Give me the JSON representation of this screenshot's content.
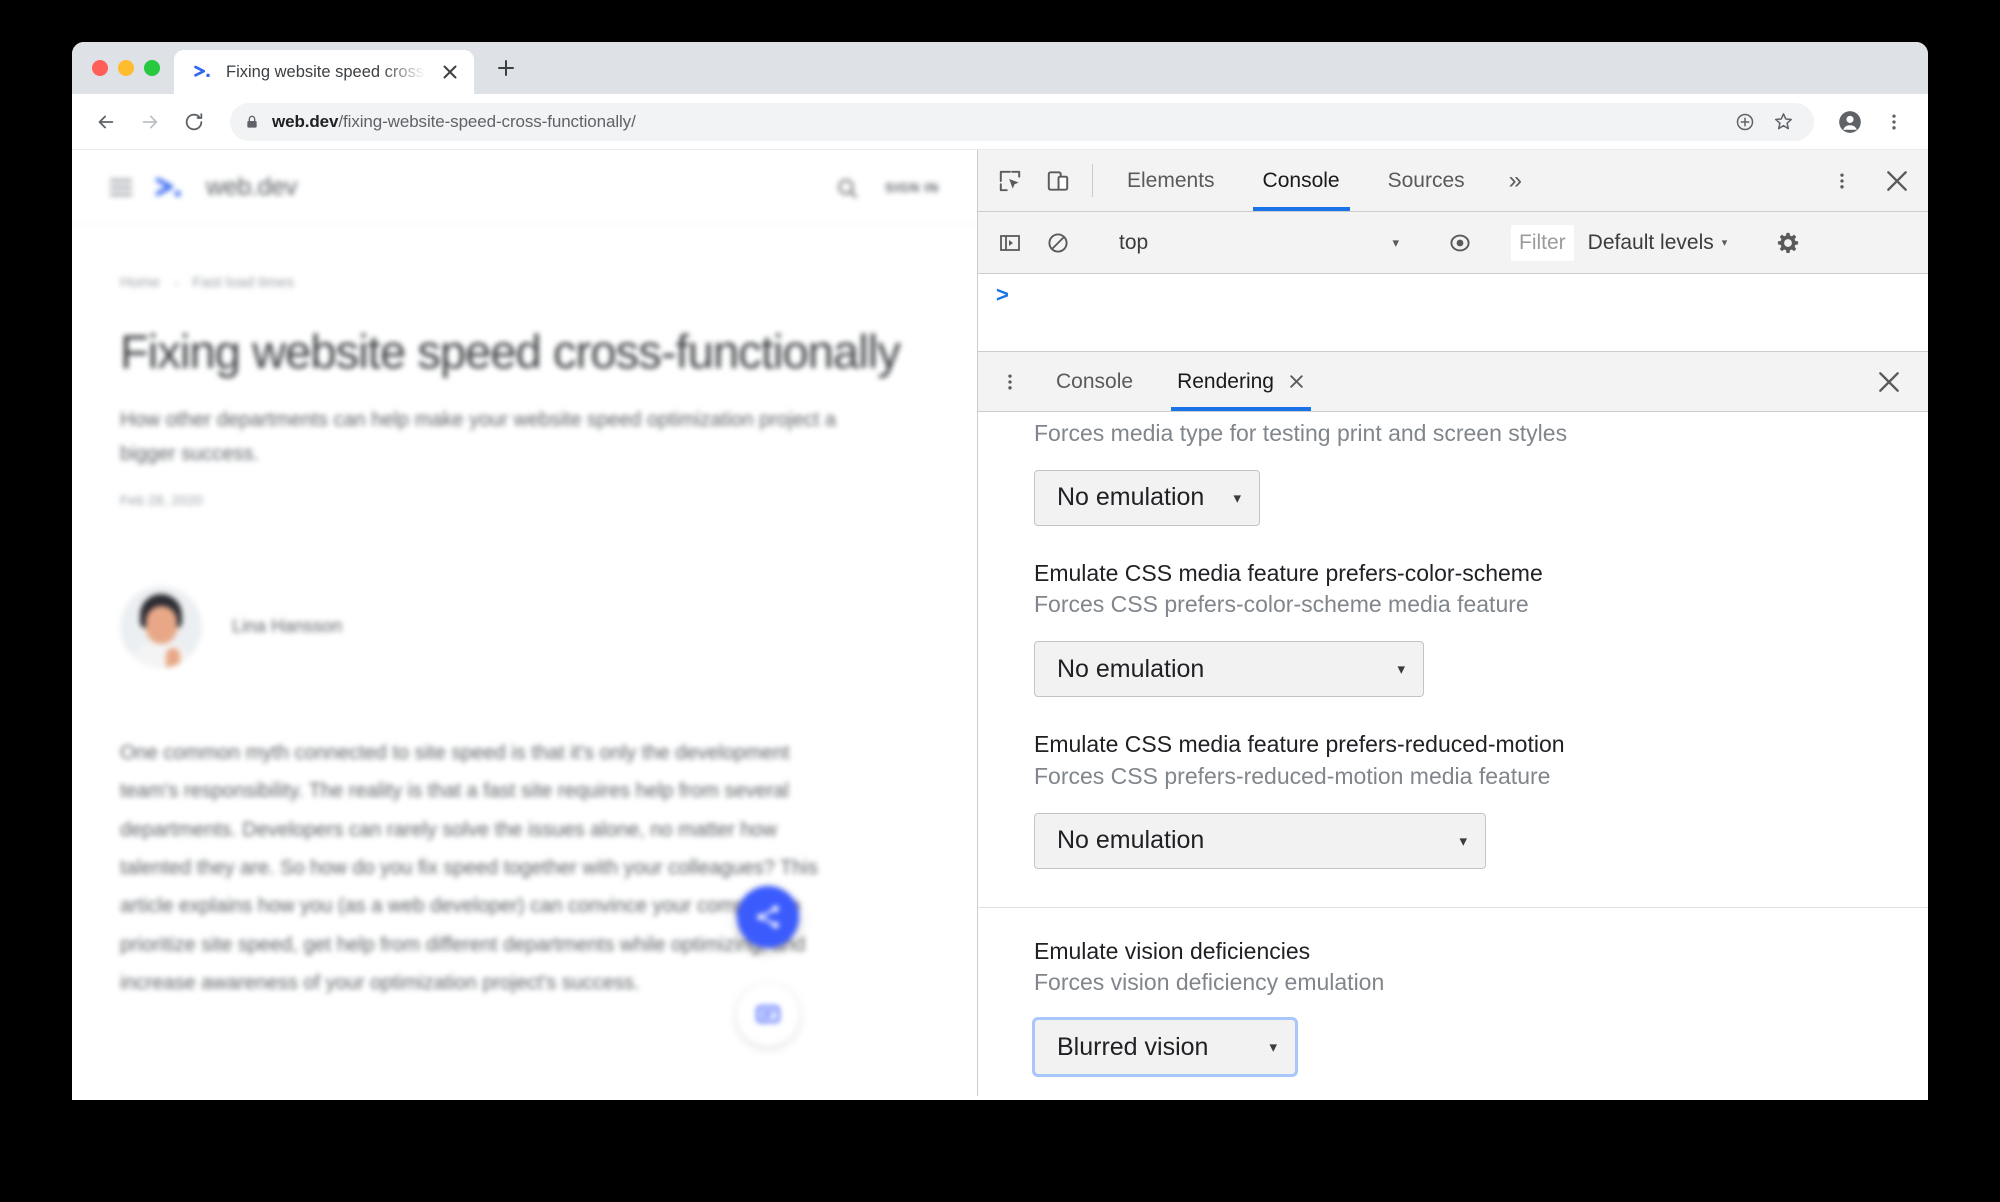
{
  "browser": {
    "tab": {
      "title": "Fixing website speed cross-fun",
      "favicon_name": "webdev-favicon",
      "close_label": "×",
      "new_tab_label": "+"
    },
    "toolbar": {
      "back_label": "←",
      "forward_label": "→",
      "reload_label": "⟳",
      "url_domain": "web.dev",
      "url_path": "/fixing-website-speed-cross-functionally/",
      "lock_icon": "lock-icon",
      "install_icon": "install-app-icon",
      "bookmark_icon": "star-icon",
      "profile_icon": "profile-avatar-icon",
      "menu_icon": "three-dot-menu-icon"
    }
  },
  "page": {
    "header": {
      "menu_icon": "hamburger-icon",
      "logo_text": "web.dev",
      "search_icon": "search-icon",
      "sign_in_label": "SIGN IN"
    },
    "breadcrumb": {
      "home": "Home",
      "separator": "›",
      "current": "Fast load times"
    },
    "article": {
      "title": "Fixing website speed cross-functionally",
      "subtitle": "How other departments can help make your website speed optimization project a bigger success.",
      "date": "Feb 28, 2020",
      "author_name": "Lina Hansson",
      "body": "One common myth connected to site speed is that it's only the development team's responsibility. The reality is that a fast site requires help from several departments. Developers can rarely solve the issues alone, no matter how talented they are. So how do you fix speed together with your colleagues? This article explains how you (as a web developer) can convince your company to prioritize site speed, get help from different departments while optimizing, and increase awareness of your optimization project's success."
    },
    "fab": {
      "share_icon": "share-icon",
      "feedback_icon": "feedback-icon"
    }
  },
  "devtools": {
    "toolbar": {
      "inspect_icon": "inspect-element-icon",
      "device_icon": "device-toolbar-icon",
      "tabs": [
        {
          "label": "Elements",
          "active": false
        },
        {
          "label": "Console",
          "active": true
        },
        {
          "label": "Sources",
          "active": false
        }
      ],
      "more_tabs_label": "»",
      "menu_icon": "three-dot-menu-icon",
      "close_icon": "close-icon"
    },
    "console_toolbar": {
      "sidebar_icon": "console-sidebar-icon",
      "clear_icon": "clear-console-icon",
      "context": "top",
      "context_caret": "▾",
      "eye_icon": "live-expression-icon",
      "filter_placeholder": "Filter",
      "levels_label": "Default levels",
      "levels_caret": "▾",
      "settings_icon": "gear-icon"
    },
    "console_prompt": ">",
    "drawer": {
      "menu_icon": "drawer-more-options-icon",
      "tabs": [
        {
          "label": "Console",
          "active": false,
          "closeable": false
        },
        {
          "label": "Rendering",
          "active": true,
          "closeable": true,
          "close_label": "×"
        }
      ],
      "close_icon": "close-drawer-icon"
    },
    "rendering": {
      "sections": [
        {
          "title": "",
          "desc": "Forces media type for testing print and screen styles",
          "value": "No emulation",
          "caret": "▾",
          "focused": false,
          "width": "w1",
          "divided": false
        },
        {
          "title": "Emulate CSS media feature prefers-color-scheme",
          "desc": "Forces CSS prefers-color-scheme media feature",
          "value": "No emulation",
          "caret": "▾",
          "focused": false,
          "width": "w2",
          "divided": false
        },
        {
          "title": "Emulate CSS media feature prefers-reduced-motion",
          "desc": "Forces CSS prefers-reduced-motion media feature",
          "value": "No emulation",
          "caret": "▾",
          "focused": false,
          "width": "w3",
          "divided": false
        },
        {
          "title": "Emulate vision deficiencies",
          "desc": "Forces vision deficiency emulation",
          "value": "Blurred vision",
          "caret": "▾",
          "focused": true,
          "width": "w4",
          "divided": true
        }
      ]
    }
  },
  "colors": {
    "accent_blue": "#1a73e8",
    "tab_strip": "#dee1e6",
    "devtools_chrome": "#f3f3f3",
    "fab_blue": "#3b5bfd",
    "focus_ring": "#a8c7fa"
  }
}
